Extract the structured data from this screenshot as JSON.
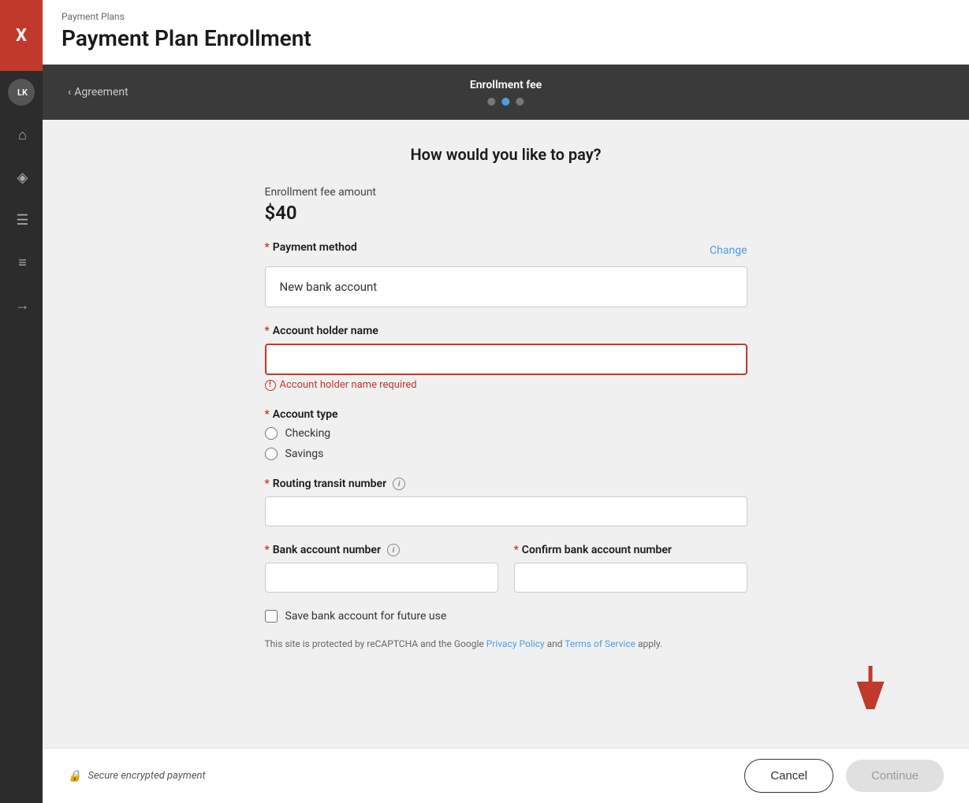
{
  "app": {
    "logo": "X",
    "logo_bg": "#c0392b"
  },
  "sidebar": {
    "items": [
      {
        "icon": "LK",
        "label": "user-avatar",
        "active": false
      },
      {
        "icon": "⌂",
        "label": "home-icon",
        "active": false
      },
      {
        "icon": "◈",
        "label": "diamond-icon",
        "active": false
      },
      {
        "icon": "≡",
        "label": "list-icon",
        "active": false
      },
      {
        "icon": "☰",
        "label": "menu-icon",
        "active": false
      },
      {
        "icon": "→",
        "label": "arrow-icon",
        "active": false
      }
    ]
  },
  "header": {
    "breadcrumb": "Payment Plans",
    "title": "Payment Plan Enrollment"
  },
  "wizard": {
    "back_label": "Agreement",
    "step_label": "Enrollment fee",
    "dots": [
      {
        "active": false
      },
      {
        "active": true
      },
      {
        "active": false
      }
    ]
  },
  "form": {
    "how_to_pay": "How would you like to pay?",
    "enrollment_fee_label": "Enrollment fee amount",
    "enrollment_fee_amount": "$40",
    "payment_method_label": "Payment method",
    "change_label": "Change",
    "payment_method_value": "New bank account",
    "account_holder_label": "Account holder name",
    "account_holder_error": "Account holder name required",
    "account_holder_placeholder": "",
    "account_type_label": "Account type",
    "account_types": [
      {
        "value": "checking",
        "label": "Checking",
        "checked": false
      },
      {
        "value": "savings",
        "label": "Savings",
        "checked": false
      }
    ],
    "routing_label": "Routing transit number",
    "routing_info_title": "Routing transit number info",
    "routing_placeholder": "",
    "bank_account_label": "Bank account number",
    "bank_account_info_title": "Bank account number info",
    "bank_account_placeholder": "",
    "confirm_bank_label": "Confirm bank account number",
    "confirm_bank_placeholder": "",
    "save_account_label": "Save bank account for future use",
    "recaptcha_text": "This site is protected by reCAPTCHA and the Google",
    "privacy_policy_label": "Privacy Policy",
    "and_text": "and",
    "terms_label": "Terms of Service",
    "apply_text": "apply."
  },
  "footer": {
    "secure_label": "Secure encrypted payment",
    "cancel_label": "Cancel",
    "continue_label": "Continue"
  }
}
